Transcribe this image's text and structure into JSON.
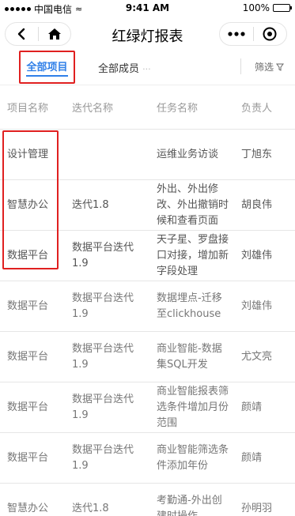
{
  "status_bar": {
    "carrier": "中国电信",
    "time": "9:41 AM",
    "battery": "100%"
  },
  "nav": {
    "title": "红绿灯报表",
    "back_icon": "chevron-left-icon",
    "home_icon": "home-icon",
    "more_icon": "more-dots-icon",
    "close_icon": "target-circle-icon"
  },
  "filters": {
    "all_projects": "全部项目",
    "all_members": "全部成员",
    "filter_label": "筛选",
    "accent_color": "#2f7fe8"
  },
  "table": {
    "headers": [
      "项目名称",
      "迭代名称",
      "任务名称",
      "负责人"
    ],
    "rows": [
      {
        "project": "设计管理",
        "iteration": "",
        "task": "运维业务访谈",
        "owner": "丁旭东"
      },
      {
        "project": "智慧办公",
        "iteration": "迭代1.8",
        "task": "外出、外出修改、外出撤销时候和查看页面",
        "owner": "胡良伟"
      },
      {
        "project": "数据平台",
        "iteration": "数据平台迭代1.9",
        "task": "天子星、罗盘接口对接，增加新字段处理",
        "owner": "刘雄伟"
      },
      {
        "project": "数据平台",
        "iteration": "数据平台迭代1.9",
        "task": "数据埋点-迁移至clickhouse",
        "owner": "刘雄伟"
      },
      {
        "project": "数据平台",
        "iteration": "数据平台迭代1.9",
        "task": "商业智能-数据集SQL开发",
        "owner": "尤文亮"
      },
      {
        "project": "数据平台",
        "iteration": "数据平台迭代1.9",
        "task": "商业智能报表筛选条件增加月份范围",
        "owner": "颜靖"
      },
      {
        "project": "数据平台",
        "iteration": "数据平台迭代1.9",
        "task": "商业智能筛选条件添加年份",
        "owner": "颜靖"
      },
      {
        "project": "智慧办公",
        "iteration": "迭代1.8",
        "task": "考勤通-外出创建时操作",
        "owner": "孙明羽"
      }
    ]
  },
  "highlight_color": "#e02020"
}
